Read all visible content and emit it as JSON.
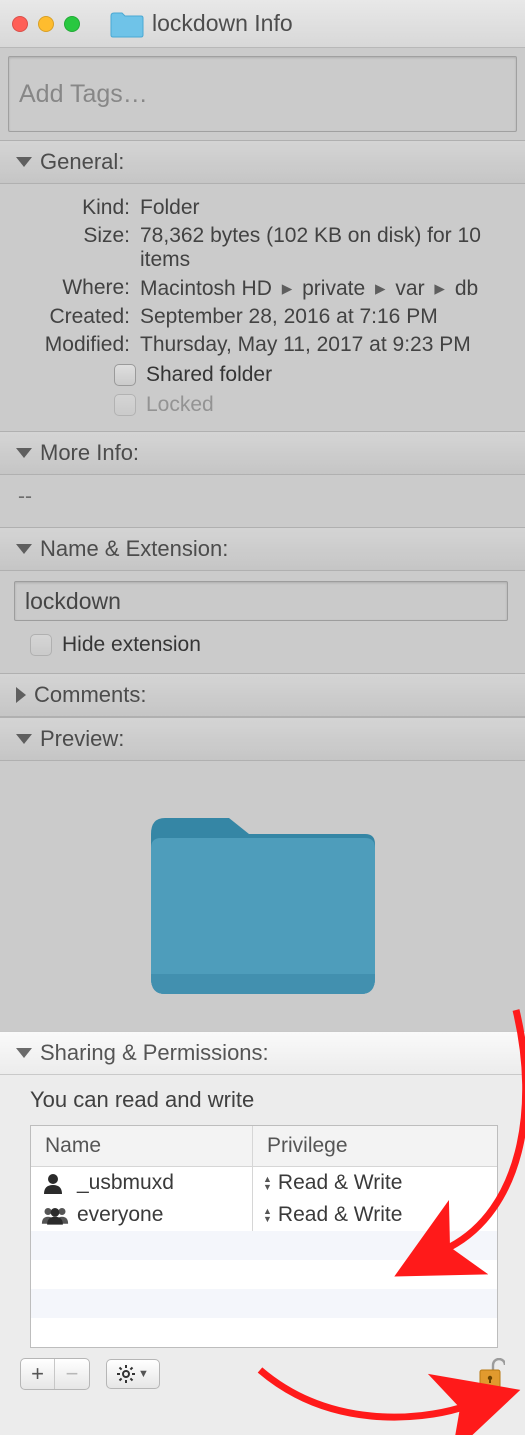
{
  "window": {
    "title": "lockdown Info"
  },
  "tags": {
    "placeholder": "Add Tags…"
  },
  "sections": {
    "general": {
      "title": "General:",
      "kind_label": "Kind:",
      "kind_value": "Folder",
      "size_label": "Size:",
      "size_value": "78,362 bytes (102 KB on disk) for 10 items",
      "where_label": "Where:",
      "where_parts": [
        "Macintosh HD",
        "private",
        "var",
        "db"
      ],
      "created_label": "Created:",
      "created_value": "September 28, 2016 at 7:16 PM",
      "modified_label": "Modified:",
      "modified_value": "Thursday, May 11, 2017 at 9:23 PM",
      "shared_folder_label": "Shared folder",
      "locked_label": "Locked"
    },
    "moreinfo": {
      "title": "More Info:",
      "value": "--"
    },
    "nameext": {
      "title": "Name & Extension:",
      "name_value": "lockdown",
      "hide_ext_label": "Hide extension"
    },
    "comments": {
      "title": "Comments:"
    },
    "preview": {
      "title": "Preview:"
    },
    "sharing": {
      "title": "Sharing & Permissions:",
      "message": "You can read and write",
      "headers": {
        "name": "Name",
        "privilege": "Privilege"
      },
      "rows": [
        {
          "name": "_usbmuxd",
          "privilege": "Read & Write",
          "icon": "single"
        },
        {
          "name": "everyone",
          "privilege": "Read & Write",
          "icon": "group"
        }
      ]
    }
  },
  "footer": {
    "add_label": "+",
    "remove_label": "−"
  }
}
